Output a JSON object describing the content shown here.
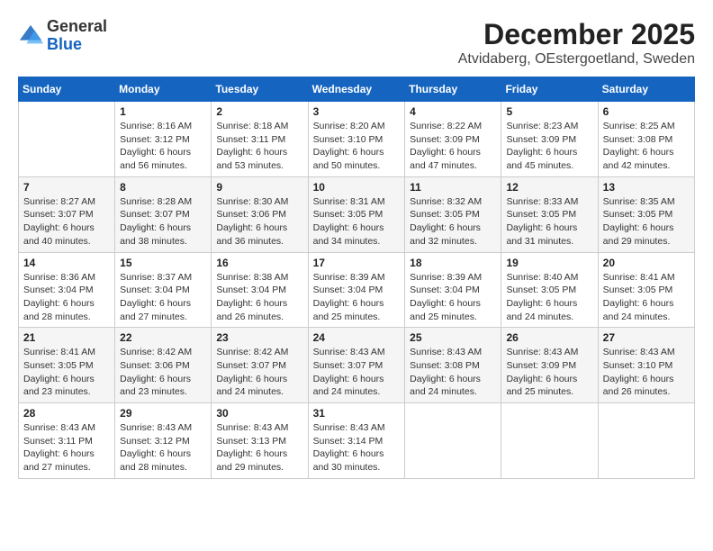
{
  "logo": {
    "general": "General",
    "blue": "Blue"
  },
  "title": {
    "month": "December 2025",
    "location": "Atvidaberg, OEstergoetland, Sweden"
  },
  "weekdays": [
    "Sunday",
    "Monday",
    "Tuesday",
    "Wednesday",
    "Thursday",
    "Friday",
    "Saturday"
  ],
  "weeks": [
    [
      {
        "day": null,
        "info": null
      },
      {
        "day": "1",
        "info": "Sunrise: 8:16 AM\nSunset: 3:12 PM\nDaylight: 6 hours\nand 56 minutes."
      },
      {
        "day": "2",
        "info": "Sunrise: 8:18 AM\nSunset: 3:11 PM\nDaylight: 6 hours\nand 53 minutes."
      },
      {
        "day": "3",
        "info": "Sunrise: 8:20 AM\nSunset: 3:10 PM\nDaylight: 6 hours\nand 50 minutes."
      },
      {
        "day": "4",
        "info": "Sunrise: 8:22 AM\nSunset: 3:09 PM\nDaylight: 6 hours\nand 47 minutes."
      },
      {
        "day": "5",
        "info": "Sunrise: 8:23 AM\nSunset: 3:09 PM\nDaylight: 6 hours\nand 45 minutes."
      },
      {
        "day": "6",
        "info": "Sunrise: 8:25 AM\nSunset: 3:08 PM\nDaylight: 6 hours\nand 42 minutes."
      }
    ],
    [
      {
        "day": "7",
        "info": "Sunrise: 8:27 AM\nSunset: 3:07 PM\nDaylight: 6 hours\nand 40 minutes."
      },
      {
        "day": "8",
        "info": "Sunrise: 8:28 AM\nSunset: 3:07 PM\nDaylight: 6 hours\nand 38 minutes."
      },
      {
        "day": "9",
        "info": "Sunrise: 8:30 AM\nSunset: 3:06 PM\nDaylight: 6 hours\nand 36 minutes."
      },
      {
        "day": "10",
        "info": "Sunrise: 8:31 AM\nSunset: 3:05 PM\nDaylight: 6 hours\nand 34 minutes."
      },
      {
        "day": "11",
        "info": "Sunrise: 8:32 AM\nSunset: 3:05 PM\nDaylight: 6 hours\nand 32 minutes."
      },
      {
        "day": "12",
        "info": "Sunrise: 8:33 AM\nSunset: 3:05 PM\nDaylight: 6 hours\nand 31 minutes."
      },
      {
        "day": "13",
        "info": "Sunrise: 8:35 AM\nSunset: 3:05 PM\nDaylight: 6 hours\nand 29 minutes."
      }
    ],
    [
      {
        "day": "14",
        "info": "Sunrise: 8:36 AM\nSunset: 3:04 PM\nDaylight: 6 hours\nand 28 minutes."
      },
      {
        "day": "15",
        "info": "Sunrise: 8:37 AM\nSunset: 3:04 PM\nDaylight: 6 hours\nand 27 minutes."
      },
      {
        "day": "16",
        "info": "Sunrise: 8:38 AM\nSunset: 3:04 PM\nDaylight: 6 hours\nand 26 minutes."
      },
      {
        "day": "17",
        "info": "Sunrise: 8:39 AM\nSunset: 3:04 PM\nDaylight: 6 hours\nand 25 minutes."
      },
      {
        "day": "18",
        "info": "Sunrise: 8:39 AM\nSunset: 3:04 PM\nDaylight: 6 hours\nand 25 minutes."
      },
      {
        "day": "19",
        "info": "Sunrise: 8:40 AM\nSunset: 3:05 PM\nDaylight: 6 hours\nand 24 minutes."
      },
      {
        "day": "20",
        "info": "Sunrise: 8:41 AM\nSunset: 3:05 PM\nDaylight: 6 hours\nand 24 minutes."
      }
    ],
    [
      {
        "day": "21",
        "info": "Sunrise: 8:41 AM\nSunset: 3:05 PM\nDaylight: 6 hours\nand 23 minutes."
      },
      {
        "day": "22",
        "info": "Sunrise: 8:42 AM\nSunset: 3:06 PM\nDaylight: 6 hours\nand 23 minutes."
      },
      {
        "day": "23",
        "info": "Sunrise: 8:42 AM\nSunset: 3:07 PM\nDaylight: 6 hours\nand 24 minutes."
      },
      {
        "day": "24",
        "info": "Sunrise: 8:43 AM\nSunset: 3:07 PM\nDaylight: 6 hours\nand 24 minutes."
      },
      {
        "day": "25",
        "info": "Sunrise: 8:43 AM\nSunset: 3:08 PM\nDaylight: 6 hours\nand 24 minutes."
      },
      {
        "day": "26",
        "info": "Sunrise: 8:43 AM\nSunset: 3:09 PM\nDaylight: 6 hours\nand 25 minutes."
      },
      {
        "day": "27",
        "info": "Sunrise: 8:43 AM\nSunset: 3:10 PM\nDaylight: 6 hours\nand 26 minutes."
      }
    ],
    [
      {
        "day": "28",
        "info": "Sunrise: 8:43 AM\nSunset: 3:11 PM\nDaylight: 6 hours\nand 27 minutes."
      },
      {
        "day": "29",
        "info": "Sunrise: 8:43 AM\nSunset: 3:12 PM\nDaylight: 6 hours\nand 28 minutes."
      },
      {
        "day": "30",
        "info": "Sunrise: 8:43 AM\nSunset: 3:13 PM\nDaylight: 6 hours\nand 29 minutes."
      },
      {
        "day": "31",
        "info": "Sunrise: 8:43 AM\nSunset: 3:14 PM\nDaylight: 6 hours\nand 30 minutes."
      },
      {
        "day": null,
        "info": null
      },
      {
        "day": null,
        "info": null
      },
      {
        "day": null,
        "info": null
      }
    ]
  ]
}
